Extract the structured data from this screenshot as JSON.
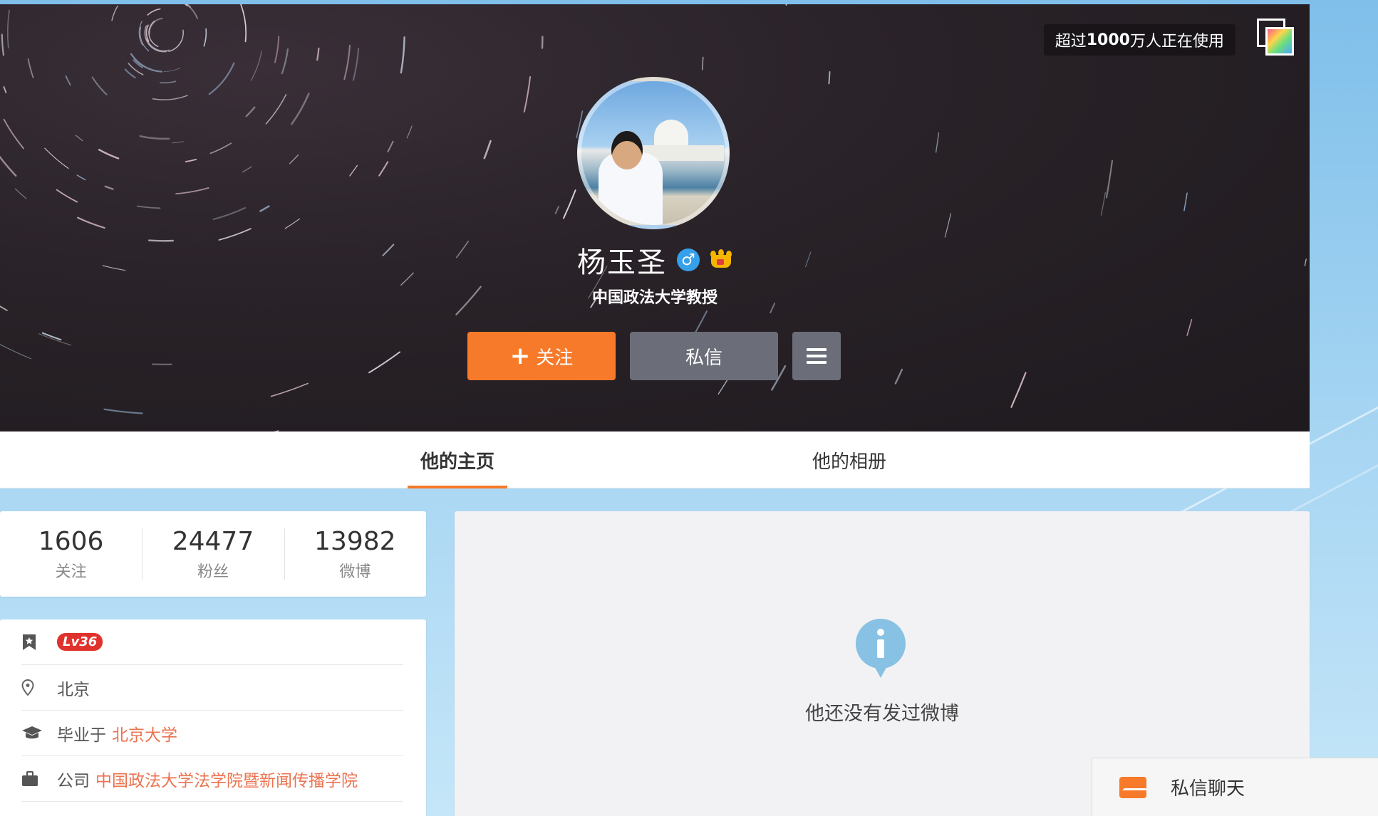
{
  "header": {
    "badge_prefix": "超过",
    "badge_bold": "1000",
    "badge_suffix": "万人正在使用",
    "corner_icon": "gradient-square-icon"
  },
  "profile": {
    "name": "杨玉圣",
    "gender_icon": "male-icon",
    "gender_glyph": "♂",
    "badge_icon": "crown-icon",
    "bio": "中国政法大学教授",
    "follow_label": "关注",
    "message_label": "私信",
    "menu_icon": "hamburger-icon"
  },
  "tabs": [
    {
      "label": "他的主页",
      "active": true
    },
    {
      "label": "他的相册",
      "active": false
    }
  ],
  "stats": [
    {
      "value": "1606",
      "label": "关注"
    },
    {
      "value": "24477",
      "label": "粉丝"
    },
    {
      "value": "13982",
      "label": "微博"
    }
  ],
  "info": {
    "level": "Lv36",
    "location": "北京",
    "edu_prefix": "毕业于",
    "edu_school": "北京大学",
    "company_prefix": "公司",
    "company_name": "中国政法大学法学院暨新闻传播学院"
  },
  "feed": {
    "empty_text": "他还没有发过微博"
  },
  "chat": {
    "label": "私信聊天"
  },
  "colors": {
    "accent": "#f77a2a",
    "link": "#eb7350",
    "button_gray": "#6b6e78",
    "level_red": "#e0322d",
    "info_blue": "#87c1e3"
  }
}
